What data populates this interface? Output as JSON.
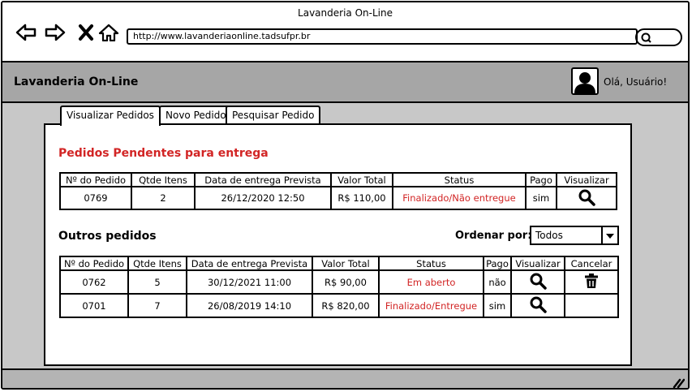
{
  "window": {
    "title": "Lavanderia On-Line"
  },
  "browser": {
    "url": "http://www.lavanderiaonline.tadsufpr.br",
    "icons": [
      "back-arrow-icon",
      "forward-arrow-icon",
      "close-x-icon",
      "home-icon",
      "search-icon"
    ]
  },
  "header": {
    "app_name": "Lavanderia On-Line",
    "greeting": "Olá, Usuário!",
    "avatar_icon": "user-avatar-icon"
  },
  "tabs": [
    {
      "label": "Visualizar Pedidos",
      "active": true
    },
    {
      "label": "Novo Pedido",
      "active": false
    },
    {
      "label": "Pesquisar Pedido",
      "active": false
    }
  ],
  "pending": {
    "title": "Pedidos Pendentes para entrega",
    "columns": [
      "Nº do Pedido",
      "Qtde Itens",
      "Data de entrega Prevista",
      "Valor Total",
      "Status",
      "Pago",
      "Visualizar"
    ],
    "rows": [
      {
        "id": "0769",
        "qty": "2",
        "date": "26/12/2020 12:50",
        "total": "R$ 110,00",
        "status": "Finalizado/Não entregue",
        "paid": "sim",
        "view_icon": "magnifier-icon"
      }
    ]
  },
  "others": {
    "title": "Outros pedidos",
    "sort_label": "Ordenar por:",
    "sort_value": "Todos",
    "columns": [
      "Nº do Pedido",
      "Qtde Itens",
      "Data de entrega Prevista",
      "Valor Total",
      "Status",
      "Pago",
      "Visualizar",
      "Cancelar"
    ],
    "rows": [
      {
        "id": "0762",
        "qty": "5",
        "date": "30/12/2021 11:00",
        "total": "R$ 90,00",
        "status": "Em aberto",
        "paid": "não",
        "view_icon": "magnifier-icon",
        "cancel_icon": "trash-icon"
      },
      {
        "id": "0701",
        "qty": "7",
        "date": "26/08/2019 14:10",
        "total": "R$ 820,00",
        "status": "Finalizado/Entregue",
        "paid": "sim",
        "view_icon": "magnifier-icon",
        "cancel_icon": ""
      }
    ]
  },
  "colors": {
    "status_red": "#d22525",
    "appbar_gray": "#a6a6a6",
    "content_gray": "#c8c8c8"
  }
}
